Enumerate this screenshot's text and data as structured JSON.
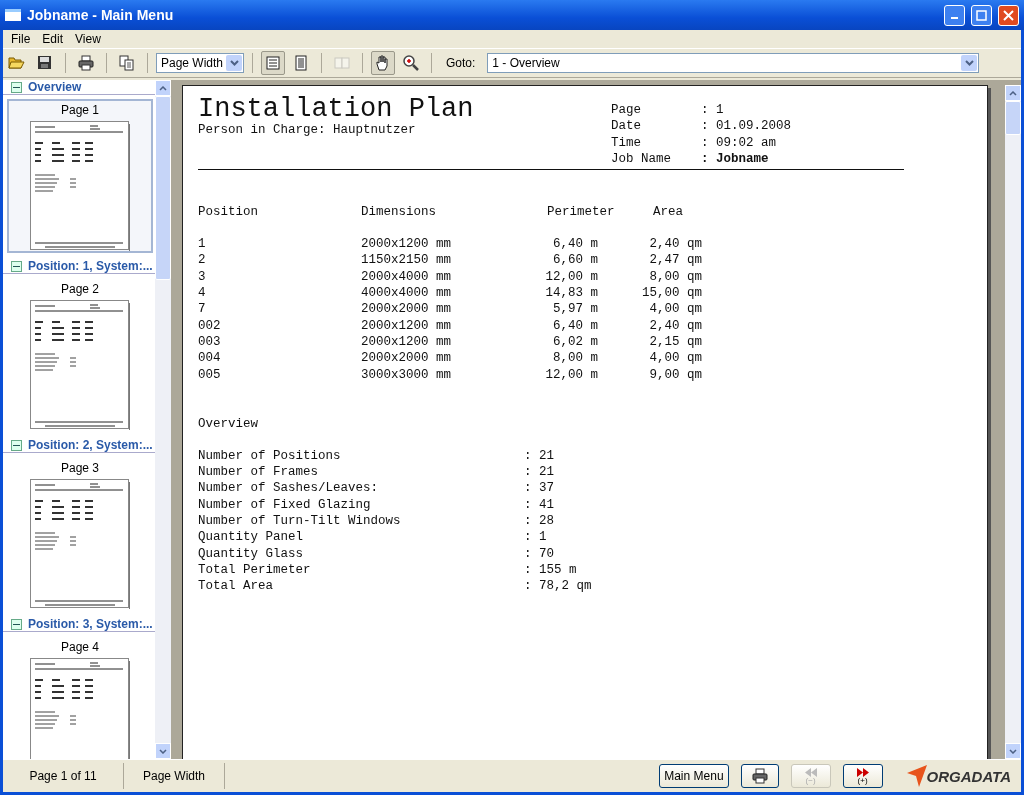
{
  "window": {
    "title": "Jobname - Main Menu"
  },
  "menu": [
    "File",
    "Edit",
    "View"
  ],
  "toolbar": {
    "tools": [
      {
        "kind": "open",
        "pressed": false,
        "disabled": false
      },
      {
        "kind": "save",
        "pressed": false,
        "disabled": false
      },
      {
        "kind": "print",
        "pressed": false,
        "disabled": false
      },
      {
        "kind": "copy",
        "pressed": false,
        "disabled": false
      },
      {
        "kind": "zoom-select",
        "value": "Page Width"
      },
      {
        "kind": "single-page",
        "pressed": true,
        "disabled": false
      },
      {
        "kind": "continuous",
        "pressed": false,
        "disabled": false
      },
      {
        "kind": "two-pages",
        "pressed": false,
        "disabled": true
      },
      {
        "kind": "hand",
        "pressed": true,
        "disabled": false
      },
      {
        "kind": "zoom",
        "pressed": false,
        "disabled": false
      }
    ],
    "goto_label": "Goto:",
    "goto_value": "1 - Overview"
  },
  "sidebar": {
    "sections": [
      {
        "title": "Overview",
        "expanded": true,
        "pages": [
          {
            "label": "Page 1",
            "selected": true
          }
        ]
      },
      {
        "title": "Position: 1, System:...",
        "expanded": true,
        "pages": [
          {
            "label": "Page 2",
            "selected": false
          }
        ]
      },
      {
        "title": "Position: 2, System:...",
        "expanded": true,
        "pages": [
          {
            "label": "Page 3",
            "selected": false
          }
        ]
      },
      {
        "title": "Position: 3, System:...",
        "expanded": true,
        "pages": [
          {
            "label": "Page 4",
            "selected": false
          }
        ]
      }
    ]
  },
  "document": {
    "title": "Installation Plan",
    "subtitle": "Person in Charge: Hauptnutzer",
    "info": [
      {
        "label": "Page",
        "value": ": 1",
        "bold": false
      },
      {
        "label": "Date",
        "value": ": 01.09.2008",
        "bold": false
      },
      {
        "label": "Time",
        "value": ": 09:02 am",
        "bold": false
      },
      {
        "label": "Job Name",
        "value": ": Jobname",
        "bold": true
      }
    ],
    "table": {
      "columns": [
        "Position",
        "Dimensions",
        "Perimeter",
        "Area"
      ],
      "rows": [
        [
          "1",
          "2000x1200 mm",
          "6,40 m",
          "2,40 qm"
        ],
        [
          "2",
          "1150x2150 mm",
          "6,60 m",
          "2,47 qm"
        ],
        [
          "3",
          "2000x4000 mm",
          "12,00 m",
          "8,00 qm"
        ],
        [
          "4",
          "4000x4000 mm",
          "14,83 m",
          "15,00 qm"
        ],
        [
          "7",
          "2000x2000 mm",
          "5,97 m",
          "4,00 qm"
        ],
        [
          "002",
          "2000x1200 mm",
          "6,40 m",
          "2,40 qm"
        ],
        [
          "003",
          "2000x1200 mm",
          "6,02 m",
          "2,15 qm"
        ],
        [
          "004",
          "2000x2000 mm",
          "8,00 m",
          "4,00 qm"
        ],
        [
          "005",
          "3000x3000 mm",
          "12,00 m",
          "9,00 qm"
        ]
      ]
    },
    "overview": {
      "title": "Overview",
      "rows": [
        {
          "label": "Number of Positions",
          "value": ": 21"
        },
        {
          "label": "Number of Frames",
          "value": ": 21"
        },
        {
          "label": "Number of Sashes/Leaves:",
          "value": ": 37"
        },
        {
          "label": "Number of Fixed Glazing",
          "value": ": 41"
        },
        {
          "label": "Number of Turn-Tilt Windows",
          "value": ": 28"
        },
        {
          "label": "Quantity Panel",
          "value": ": 1"
        },
        {
          "label": "Quantity Glass",
          "value": ": 70"
        },
        {
          "label": "Total Perimeter",
          "value": ": 155 m"
        },
        {
          "label": "Total Area",
          "value": ": 78,2 qm"
        }
      ]
    }
  },
  "status_bar": {
    "panels": [
      "Page 1 of 11",
      "Page Width"
    ],
    "buttons": [
      {
        "kind": "text",
        "label": "Main Menu",
        "disabled": false
      },
      {
        "kind": "print",
        "disabled": false
      },
      {
        "kind": "previous",
        "label": "(−)",
        "disabled": true
      },
      {
        "kind": "next",
        "label": "(+)",
        "disabled": false
      }
    ],
    "logo": "ORGADATA"
  }
}
